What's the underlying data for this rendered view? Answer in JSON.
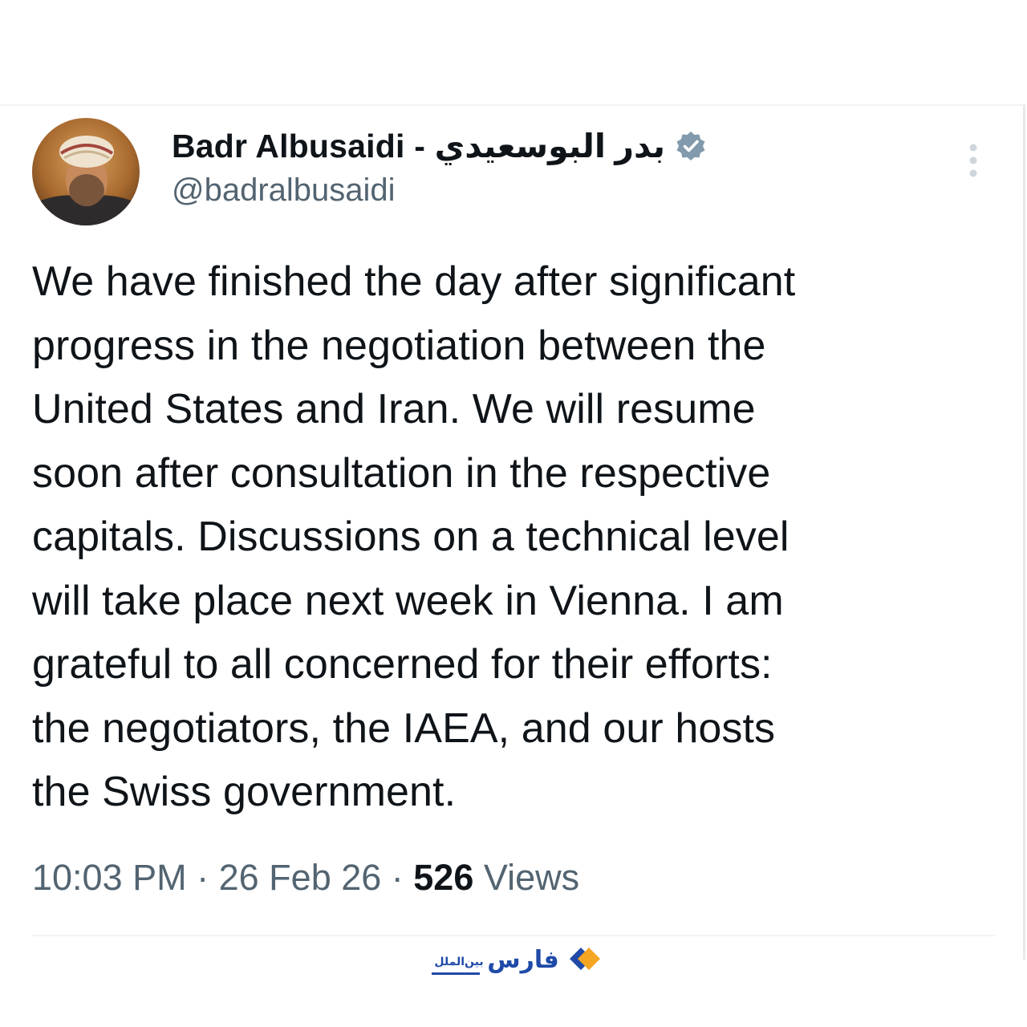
{
  "tweet": {
    "author": {
      "display_name": "Badr Albusaidi - بدر البوسعيدي",
      "handle": "@badralbusaidi",
      "verified": true,
      "avatar_icon": "user-avatar-photo"
    },
    "text_lines": [
      "We have finished the day after significant",
      "progress in the negotiation between the",
      "United States and Iran. We will resume",
      "soon after consultation in the respective",
      "capitals. Discussions on a technical level",
      "will take place next week in Vienna. I am",
      "grateful to all concerned for their efforts:",
      "the negotiators, the IAEA, and our hosts",
      "the Swiss government."
    ],
    "time": "10:03 PM",
    "separator": " · ",
    "date": "26 Feb 26",
    "views_count": "526",
    "views_label": "Views"
  },
  "watermark": {
    "brand": "فارس",
    "sub": "بین‌الملل"
  },
  "colors": {
    "text": "#0f1419",
    "secondary": "#536471",
    "verified_badge": "#829aab",
    "logo_blue": "#1f4aa8",
    "logo_orange": "#f5a623"
  },
  "icons": {
    "verified": "verified-badge-icon",
    "more": "more-options-icon",
    "logo": "fars-logo-icon"
  }
}
